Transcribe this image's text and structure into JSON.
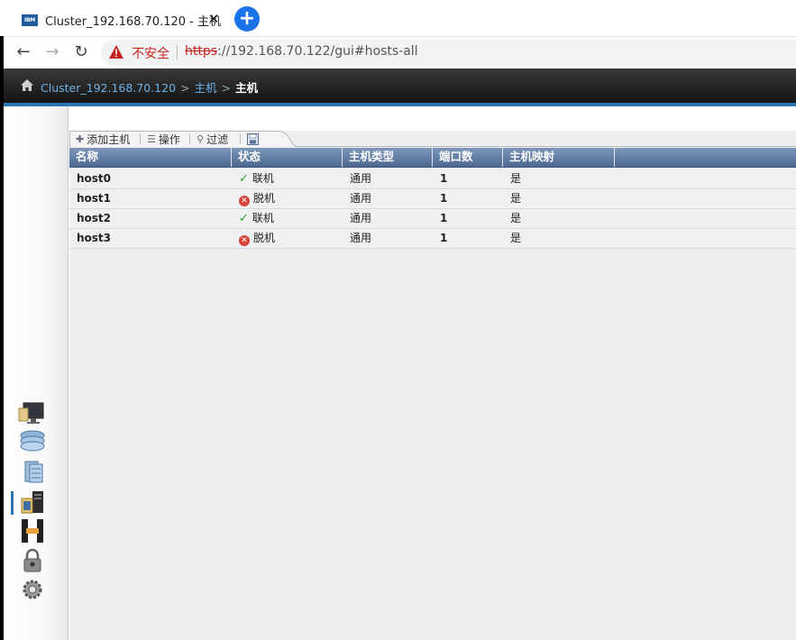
{
  "browser": {
    "tab_icon_text": "IBM",
    "tab_title": "Cluster_192.168.70.120 - 主机",
    "tab_close": "✕",
    "new_tab": "+",
    "back": "←",
    "forward": "→",
    "reload": "↻",
    "security_label": "不安全",
    "url_scheme": "https",
    "url_rest": "://192.168.70.122/gui#hosts-all"
  },
  "breadcrumb": {
    "items": [
      "Cluster_192.168.70.120",
      "主机"
    ],
    "current": "主机",
    "separator": ">"
  },
  "toolbar": {
    "add_host": "添加主机",
    "actions": "操作",
    "filter": "过滤"
  },
  "table": {
    "columns": [
      "名称",
      "状态",
      "主机类型",
      "端口数",
      "主机映射"
    ],
    "rows": [
      {
        "name": "host0",
        "status": "联机",
        "status_kind": "online",
        "type": "通用",
        "ports": "1",
        "mapping": "是"
      },
      {
        "name": "host1",
        "status": "脱机",
        "status_kind": "offline",
        "type": "通用",
        "ports": "1",
        "mapping": "是"
      },
      {
        "name": "host2",
        "status": "联机",
        "status_kind": "online",
        "type": "通用",
        "ports": "1",
        "mapping": "是"
      },
      {
        "name": "host3",
        "status": "脱机",
        "status_kind": "offline",
        "type": "通用",
        "ports": "1",
        "mapping": "是"
      }
    ]
  },
  "sidenav": {
    "items": [
      "monitoring-icon",
      "pools-icon",
      "volumes-icon",
      "hosts-icon",
      "copy-services-icon",
      "access-icon",
      "settings-icon"
    ],
    "active": "hosts-icon"
  },
  "colors": {
    "accent": "#2b73b5",
    "grid_header": "#5d779c",
    "online": "#2d9a2d",
    "offline": "#d9443a"
  }
}
